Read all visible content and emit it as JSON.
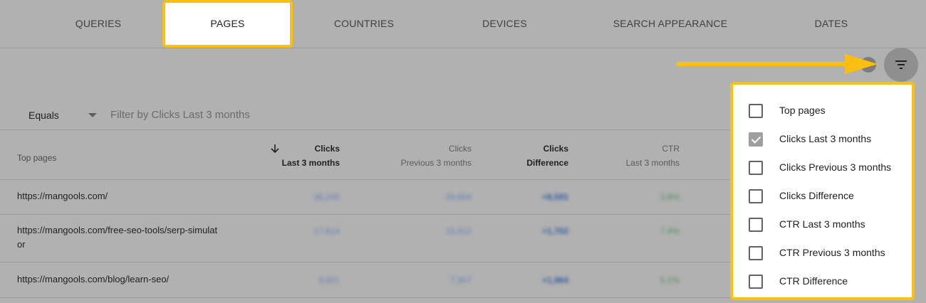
{
  "tabs": [
    {
      "label": "QUERIES"
    },
    {
      "label": "PAGES",
      "active": true
    },
    {
      "label": "COUNTRIES"
    },
    {
      "label": "DEVICES"
    },
    {
      "label": "SEARCH APPEARANCE"
    },
    {
      "label": "DATES"
    }
  ],
  "filter": {
    "operator": "Equals",
    "placeholder": "Filter by Clicks Last 3 months"
  },
  "table": {
    "first_header": "Top pages",
    "columns": [
      {
        "line1": "Clicks",
        "line2": "Last 3 months",
        "sorted": true
      },
      {
        "line1": "Clicks",
        "line2": "Previous 3 months"
      },
      {
        "line1": "Clicks",
        "line2": "Difference"
      },
      {
        "line1": "CTR",
        "line2": "Last 3 months"
      }
    ],
    "rows": [
      {
        "url_line1": "https://mangools.com/",
        "url_line2": "",
        "cells": [
          "38,245",
          "29,654",
          "+8,591",
          "3.8%"
        ]
      },
      {
        "url_line1": "https://mangools.com/free-seo-tools/serp-simulat",
        "url_line2": "or",
        "cells": [
          "17,614",
          "15,912",
          "+1,702",
          "7.4%"
        ]
      },
      {
        "url_line1": "https://mangools.com/blog/learn-seo/",
        "url_line2": "",
        "cells": [
          "9,921",
          "7,957",
          "+1,964",
          "5.1%"
        ]
      }
    ]
  },
  "column_menu": {
    "options": [
      {
        "label": "Top pages",
        "checked": false
      },
      {
        "label": "Clicks Last 3 months",
        "checked": true
      },
      {
        "label": "Clicks Previous 3 months",
        "checked": false
      },
      {
        "label": "Clicks Difference",
        "checked": false
      },
      {
        "label": "CTR Last 3 months",
        "checked": false
      },
      {
        "label": "CTR Previous 3 months",
        "checked": false
      },
      {
        "label": "CTR Difference",
        "checked": false
      }
    ]
  },
  "colors": {
    "highlight": "#fbbf0f",
    "overlay": "#b1b1b1"
  },
  "icons": {
    "filter_button": "filter-icon",
    "sort": "arrow-down-icon",
    "annotation": "arrow-right-icon"
  }
}
